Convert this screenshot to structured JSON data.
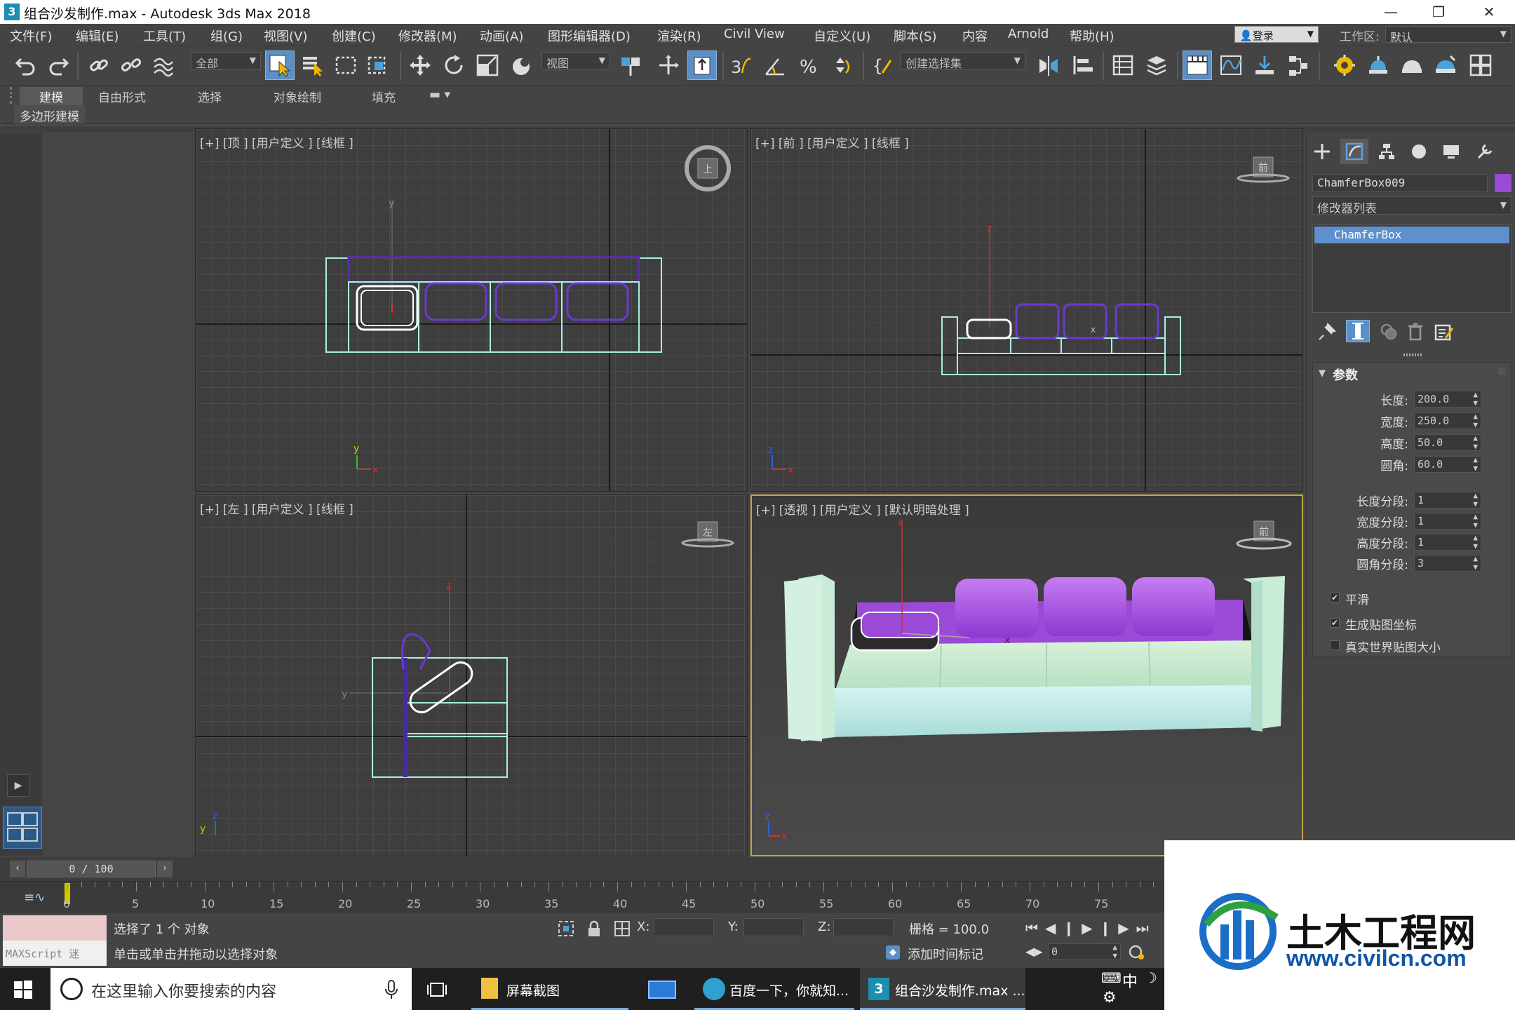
{
  "window": {
    "title": "组合沙发制作.max - Autodesk 3ds Max 2018",
    "app_icon": "3"
  },
  "menu": [
    "文件(F)",
    "编辑(E)",
    "工具(T)",
    "组(G)",
    "视图(V)",
    "创建(C)",
    "修改器(M)",
    "动画(A)",
    "图形编辑器(D)",
    "渲染(R)",
    "Civil View",
    "自定义(U)",
    "脚本(S)",
    "内容",
    "Arnold",
    "帮助(H)"
  ],
  "login_label": "登录",
  "workspace": {
    "label": "工作区:",
    "value": "默认"
  },
  "toolbar": {
    "filter": "全部",
    "ref_coord": "视图",
    "named_sel": "创建选择集"
  },
  "ribbon_tabs": [
    "建模",
    "自由形式",
    "选择",
    "对象绘制",
    "填充"
  ],
  "ribbon_active": "建模",
  "ribbon_sub": "多边形建模",
  "viewports": {
    "top": "[+] [顶 ] [用户定义 ] [线框 ]",
    "front": "[+] [前 ] [用户定义 ] [线框 ]",
    "left": "[+] [左 ] [用户定义 ] [线框 ]",
    "persp": "[+] [透视 ] [用户定义 ] [默认明暗处理 ]"
  },
  "axis_labels": {
    "x": "x",
    "y": "y",
    "z": "z"
  },
  "viewcube_labels": {
    "top": "上",
    "front": "前",
    "left": "左"
  },
  "command_panel": {
    "object_name": "ChamferBox009",
    "object_color": "#9a4ad6",
    "modifier_list": "修改器列表",
    "stack_item": "ChamferBox",
    "rollout_title": "参数",
    "params": [
      {
        "label": "长度:",
        "value": "200.0"
      },
      {
        "label": "宽度:",
        "value": "250.0"
      },
      {
        "label": "高度:",
        "value": "50.0"
      },
      {
        "label": "圆角:",
        "value": "60.0"
      }
    ],
    "segments": [
      {
        "label": "长度分段:",
        "value": "1"
      },
      {
        "label": "宽度分段:",
        "value": "1"
      },
      {
        "label": "高度分段:",
        "value": "1"
      },
      {
        "label": "圆角分段:",
        "value": "3"
      }
    ],
    "checkboxes": [
      {
        "label": "平滑",
        "checked": true
      },
      {
        "label": "生成贴图坐标",
        "checked": true
      },
      {
        "label": "真实世界贴图大小",
        "checked": false
      }
    ]
  },
  "timeline": {
    "frame": "0 / 100",
    "ticks": [
      "0",
      "5",
      "10",
      "15",
      "20",
      "25",
      "30",
      "35",
      "40",
      "45",
      "50",
      "55",
      "60",
      "65",
      "70",
      "75"
    ]
  },
  "status": {
    "maxscript": "MAXScript 迷",
    "selected": "选择了 1 个 对象",
    "prompt": "单击或单击并拖动以选择对象",
    "x_label": "X:",
    "y_label": "Y:",
    "z_label": "Z:",
    "grid": "栅格 = 100.0",
    "add_time_tag": "添加时间标记",
    "frame_value": "0"
  },
  "taskbar": {
    "search_placeholder": "在这里输入你要搜索的内容",
    "apps": [
      "屏幕截图",
      "百度一下，你就知...",
      "组合沙发制作.max ..."
    ],
    "ime": "中"
  },
  "watermark": {
    "title": "土木工程网",
    "url": "www.civilcn.com"
  }
}
